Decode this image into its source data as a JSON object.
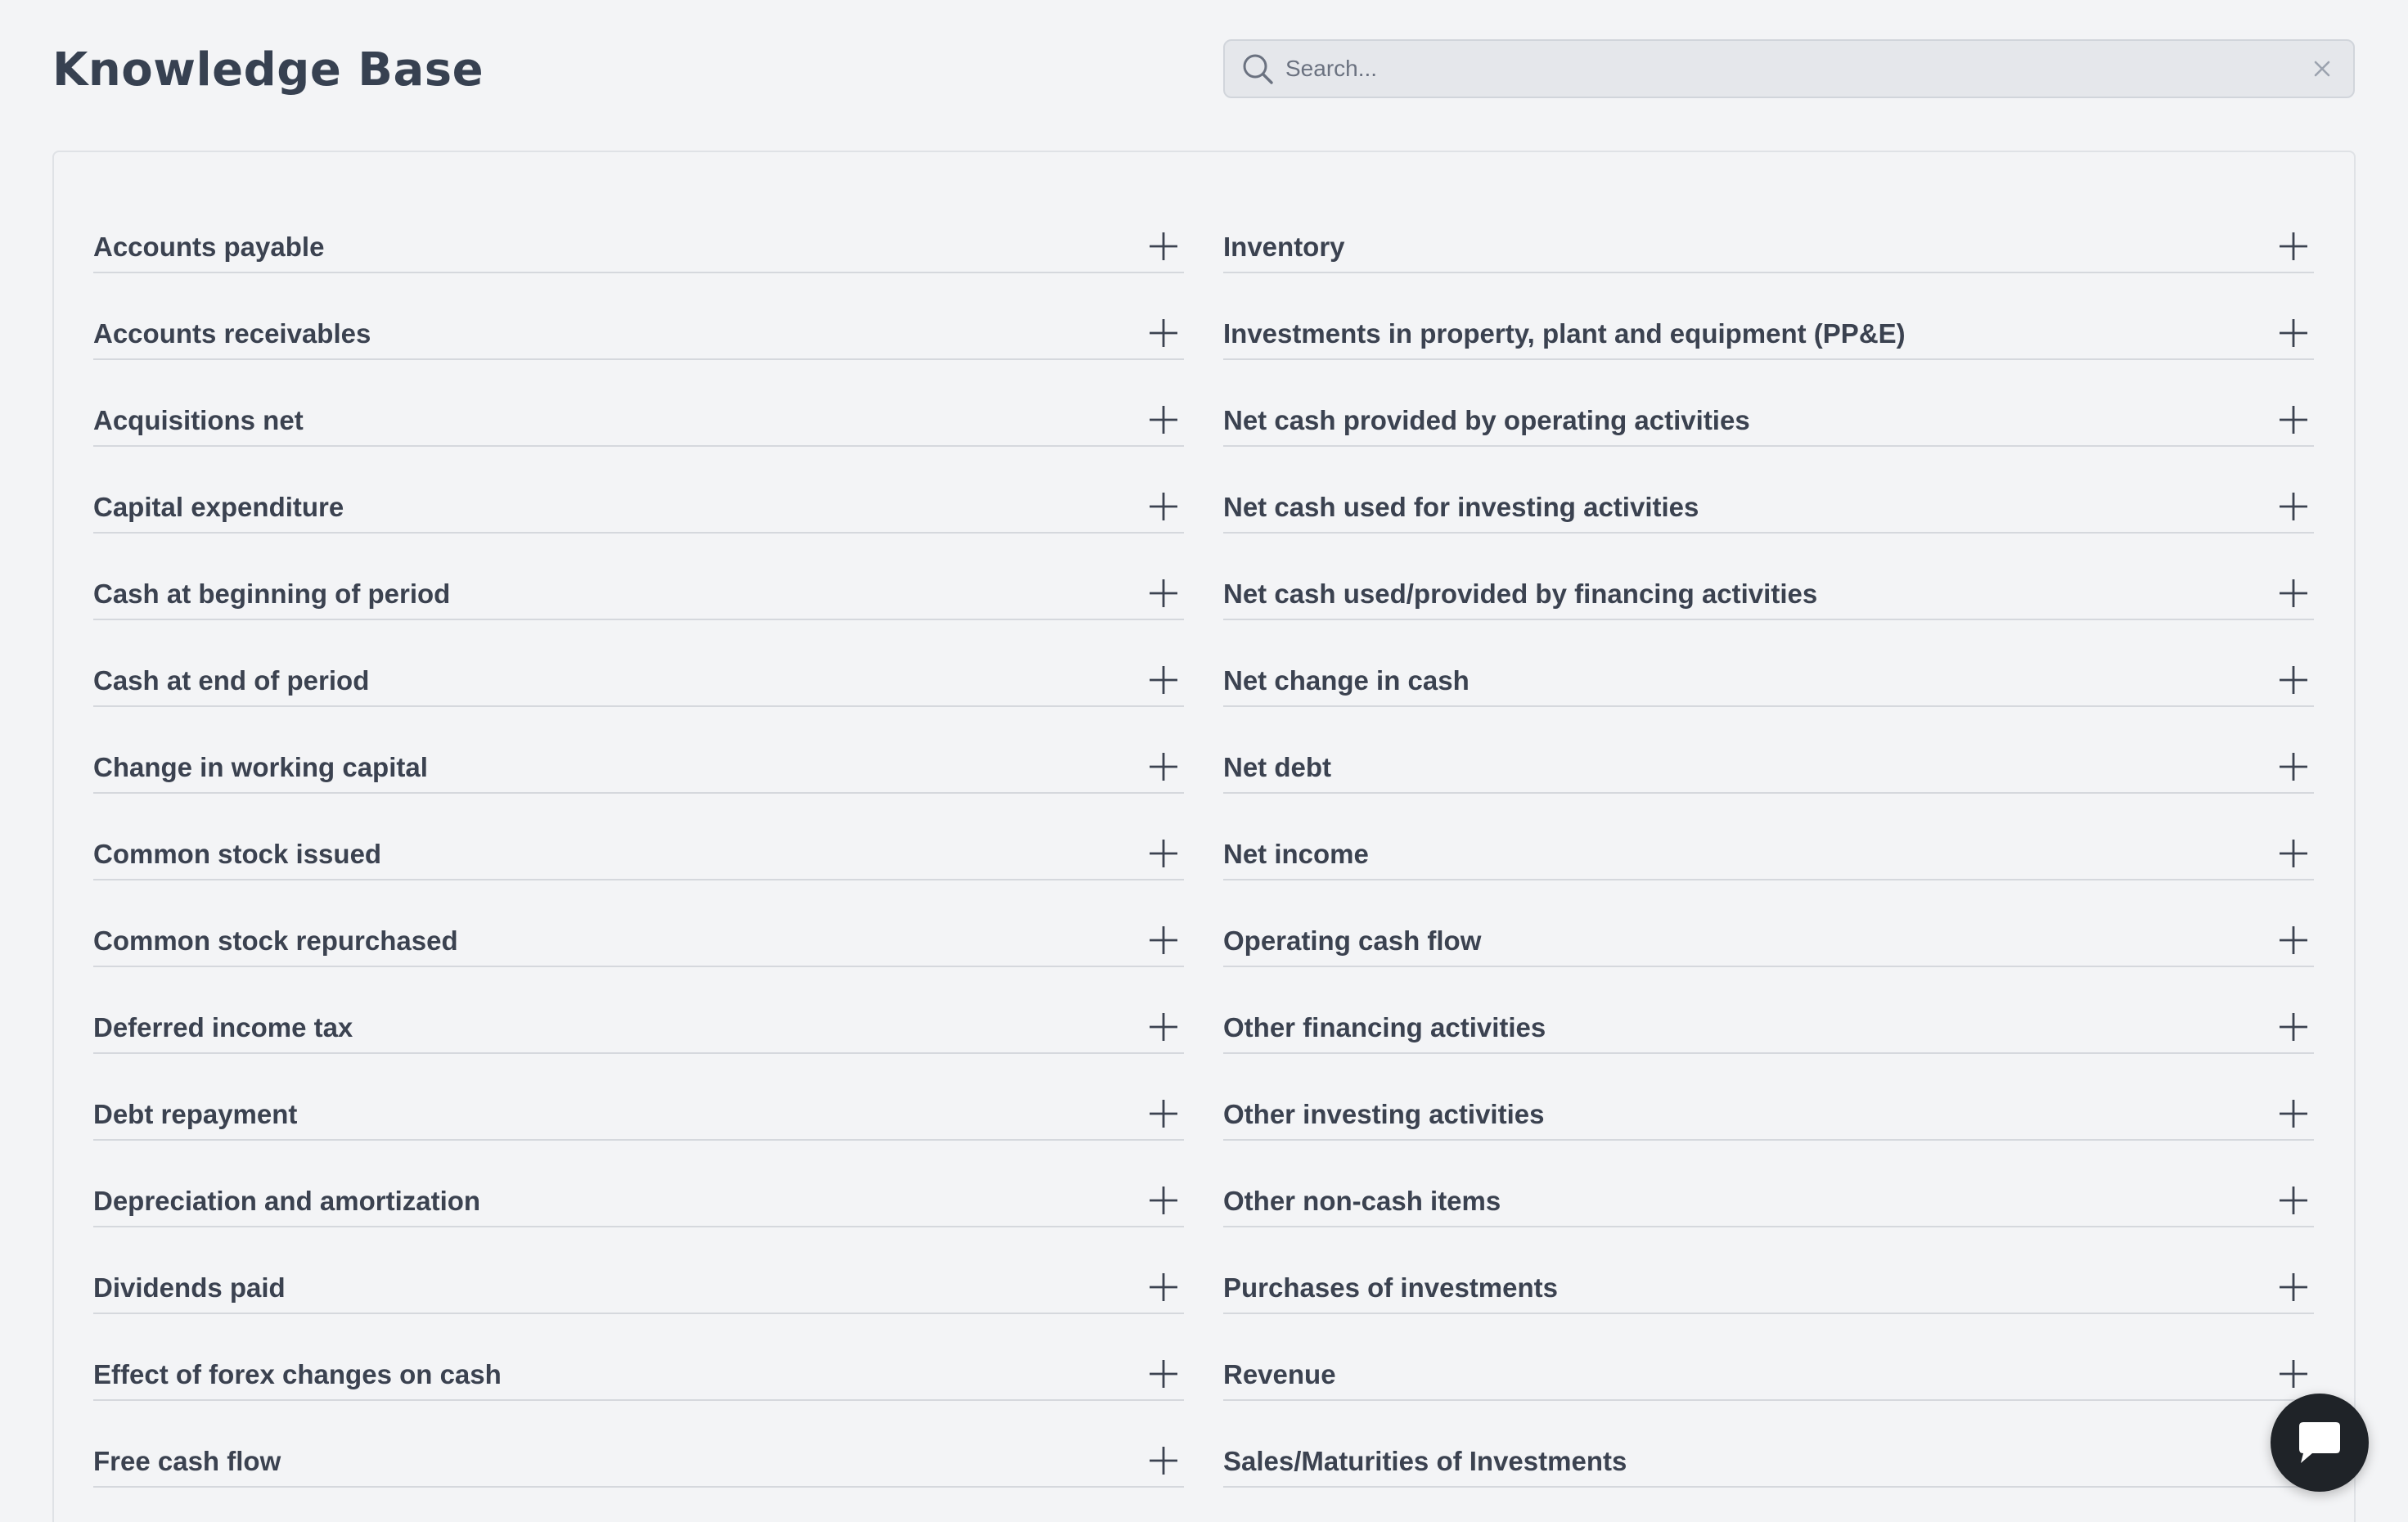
{
  "header": {
    "title": "Knowledge Base",
    "search": {
      "placeholder": "Search...",
      "value": ""
    }
  },
  "columns": {
    "left": [
      "Accounts payable",
      "Accounts receivables",
      "Acquisitions net",
      "Capital expenditure",
      "Cash at beginning of period",
      "Cash at end of period",
      "Change in working capital",
      "Common stock issued",
      "Common stock repurchased",
      "Deferred income tax",
      "Debt repayment",
      "Depreciation and amortization",
      "Dividends paid",
      "Effect of forex changes on cash",
      "Free cash flow"
    ],
    "right": [
      "Inventory",
      "Investments in property, plant and equipment (PP&E)",
      "Net cash provided by operating activities",
      "Net cash used for investing activities",
      "Net cash used/provided by financing activities",
      "Net change in cash",
      "Net debt",
      "Net income",
      "Operating cash flow",
      "Other financing activities",
      "Other investing activities",
      "Other non-cash items",
      "Purchases of investments",
      "Revenue",
      "Sales/Maturities of Investments"
    ]
  },
  "icons": {
    "search": "search-icon",
    "clear": "close-icon",
    "expand": "plus-icon",
    "chat": "chat-bubble-icon"
  },
  "colors": {
    "background": "#f3f4f6",
    "text": "#374151",
    "chat_button": "#1f2328"
  }
}
